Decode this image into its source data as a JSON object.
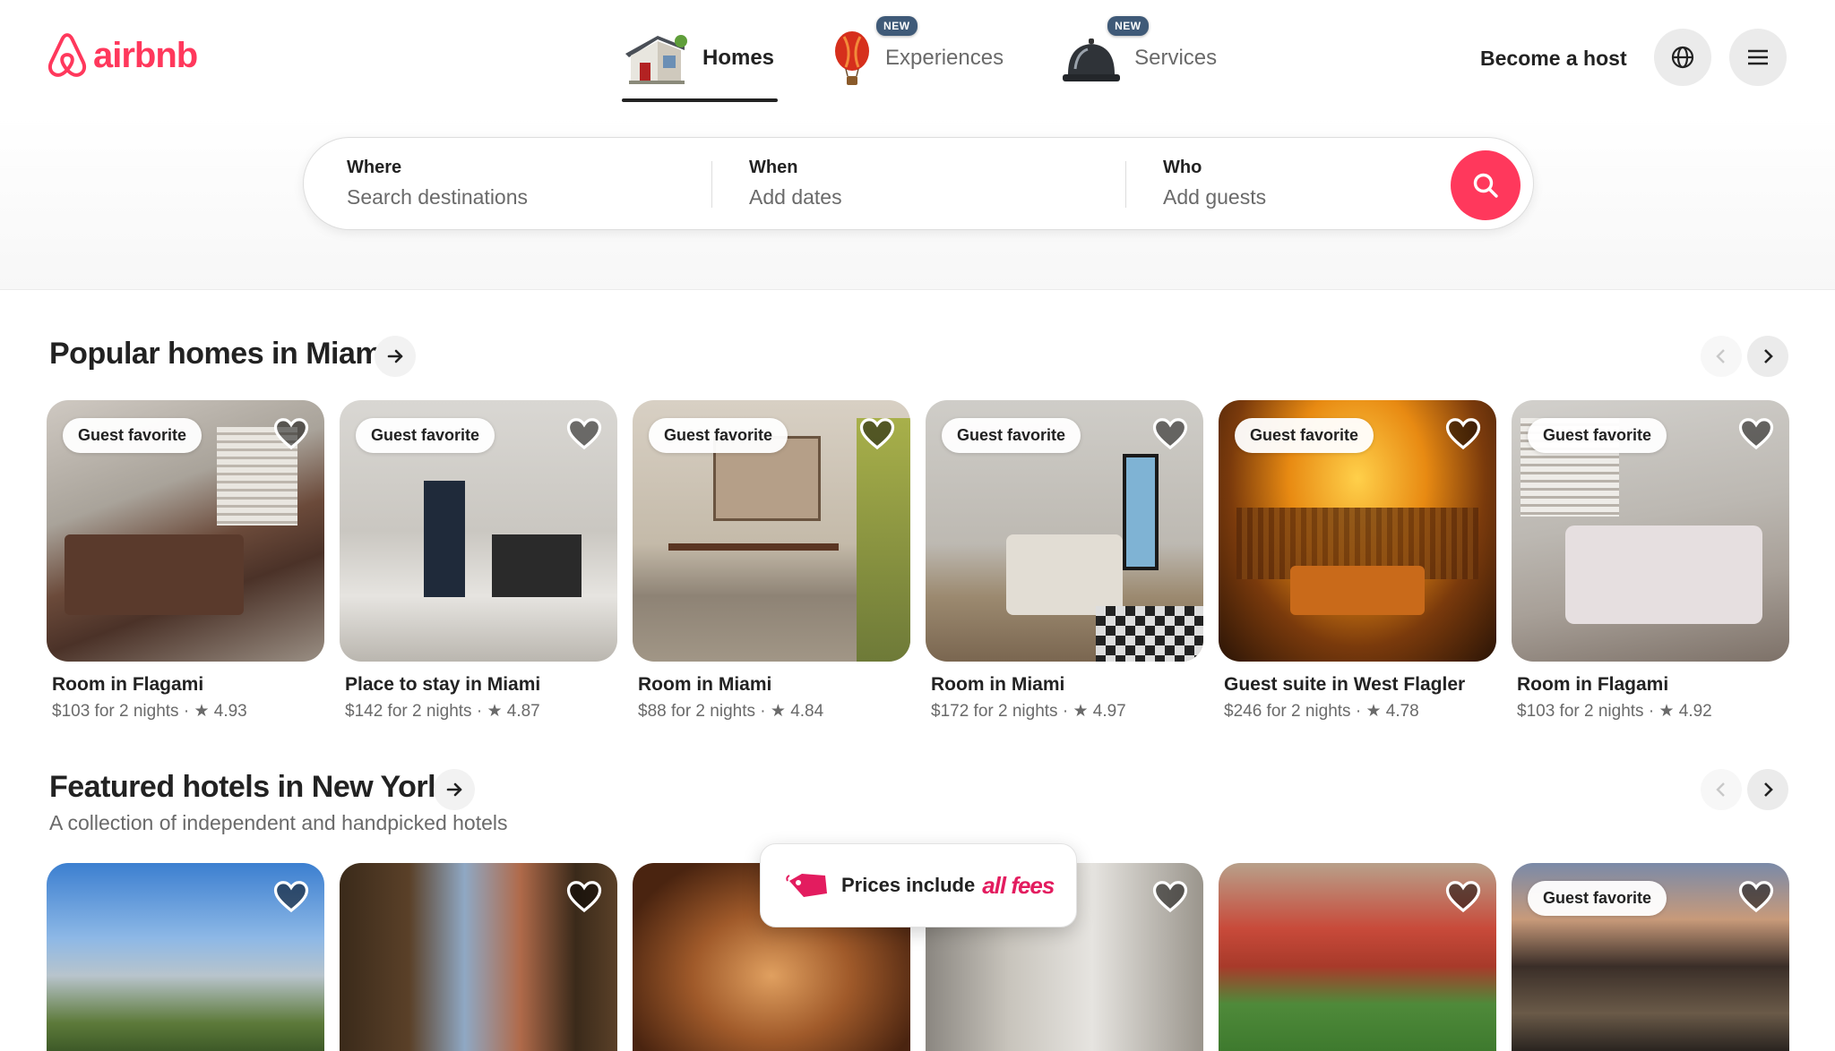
{
  "brand": {
    "name": "airbnb",
    "color": "#ff385c"
  },
  "nav": {
    "tabs": [
      {
        "label": "Homes",
        "icon": "house-icon",
        "active": true
      },
      {
        "label": "Experiences",
        "icon": "hot-air-balloon-icon",
        "badge": "NEW"
      },
      {
        "label": "Services",
        "icon": "service-bell-icon",
        "badge": "NEW"
      }
    ],
    "host_label": "Become a host"
  },
  "search": {
    "where": {
      "title": "Where",
      "placeholder": "Search destinations"
    },
    "when": {
      "title": "When",
      "placeholder": "Add dates"
    },
    "who": {
      "title": "Who",
      "placeholder": "Add guests"
    }
  },
  "popular": {
    "title": "Popular homes in Miami",
    "cards": [
      {
        "badge": "Guest favorite",
        "title": "Room in Flagami",
        "price": "$103 for 2 nights",
        "rating": "4.93"
      },
      {
        "badge": "Guest favorite",
        "title": "Place to stay in Miami",
        "price": "$142 for 2 nights",
        "rating": "4.87"
      },
      {
        "badge": "Guest favorite",
        "title": "Room in Miami",
        "price": "$88 for 2 nights",
        "rating": "4.84"
      },
      {
        "badge": "Guest favorite",
        "title": "Room in Miami",
        "price": "$172 for 2 nights",
        "rating": "4.97"
      },
      {
        "badge": "Guest favorite",
        "title": "Guest suite in West Flagler",
        "price": "$246 for 2 nights",
        "rating": "4.78"
      },
      {
        "badge": "Guest favorite",
        "title": "Room in Flagami",
        "price": "$103 for 2 nights",
        "rating": "4.92"
      }
    ]
  },
  "hotels": {
    "title": "Featured hotels in New York",
    "subtitle": "A collection of independent and handpicked hotels",
    "cards": [
      {},
      {},
      {},
      {},
      {},
      {
        "badge": "Guest favorite"
      }
    ]
  },
  "toast": {
    "text_a": "Prices include",
    "text_b": "all fees"
  },
  "colors": {
    "accent": "#ff385c",
    "badge_bg": "#3f5a78",
    "muted": "#6a6a6a"
  }
}
